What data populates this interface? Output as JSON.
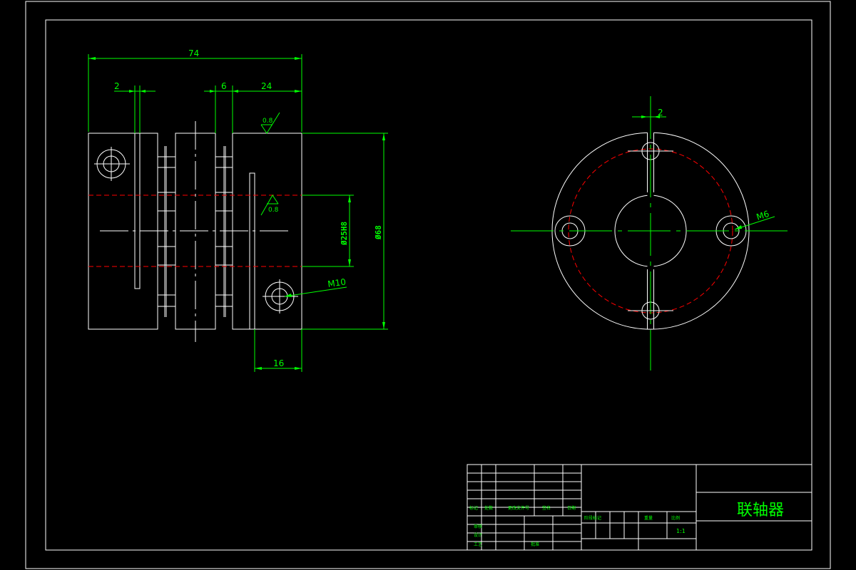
{
  "drawing": {
    "title": "联轴器",
    "scale": "1:1",
    "colors": {
      "outline": "#ffffff",
      "dimension": "#00ff00",
      "hidden": "#ff0000",
      "background": "#000000"
    }
  },
  "front_view": {
    "dim_overall_length": "74",
    "dim_slot": "2",
    "dim_spacer": "6",
    "dim_hub": "24",
    "dim_bore": "Ø25H8",
    "dim_outer": "Ø68",
    "dim_screw_offset": "16",
    "thread_label": "M10",
    "roughness_top": "0.8",
    "roughness_bore": "0.8"
  },
  "side_view": {
    "dim_slot": "2",
    "thread_label": "M6"
  },
  "title_block": {
    "header_labels": [
      "标记",
      "处数",
      "更改文件号",
      "签名",
      "日期"
    ],
    "design_label": "设计",
    "check_label": "审核",
    "process_label": "工艺",
    "approve_label": "批准",
    "stage_labels": [
      "阶段标记",
      "重量",
      "比例"
    ],
    "scale_value": "1:1"
  }
}
